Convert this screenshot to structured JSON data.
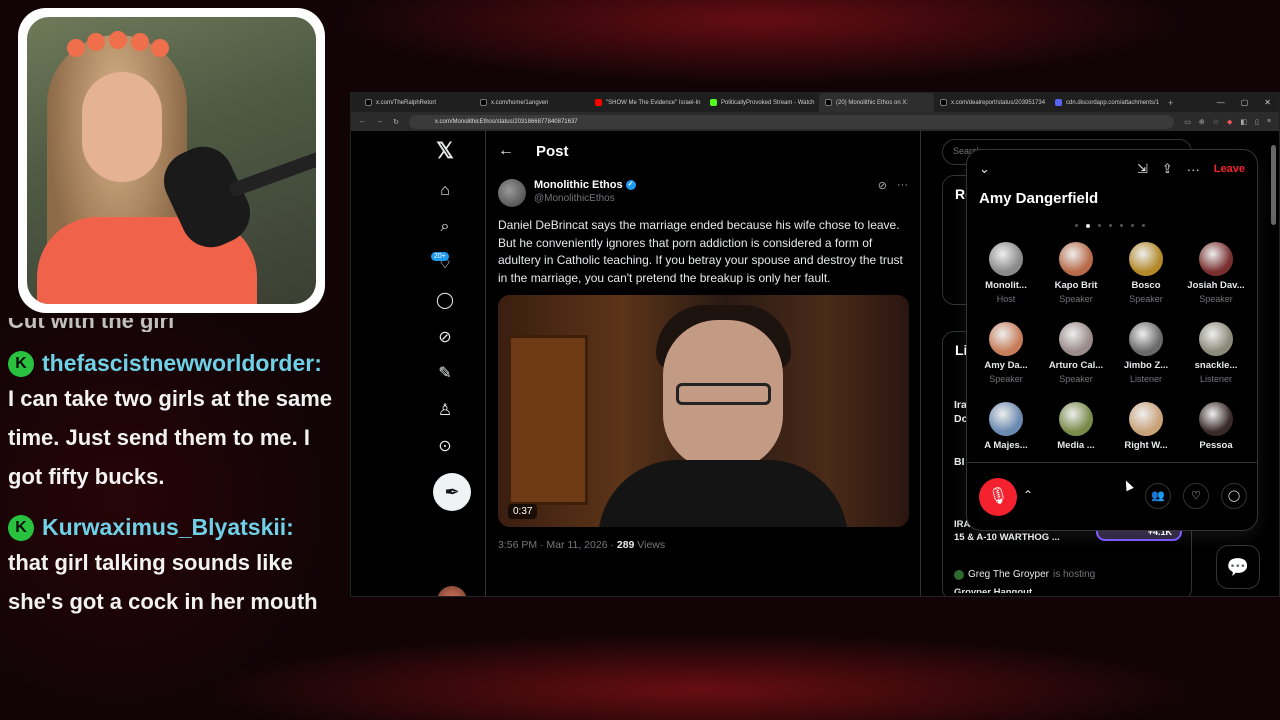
{
  "chat": {
    "cut_line": "Cut with the girl",
    "messages": [
      {
        "badge": "K",
        "user": "thefascistnewworldorder:",
        "text": "I can take two girls at the same time. Just send them to me. I got fifty bucks."
      },
      {
        "badge": "K",
        "user": "Kurwaximus_Blyatskii:",
        "text": "that girl talking sounds like she's got a cock in her mouth"
      }
    ]
  },
  "browser": {
    "tabs": [
      {
        "label": "x.com/TheRalphRetort",
        "color": "#000000"
      },
      {
        "label": "x.com/home/1angven",
        "color": "#000000"
      },
      {
        "label": "\"SHOW Me The Evidence\" Israel-In",
        "color": "#ff0000"
      },
      {
        "label": "PoliticallyProvoked Stream - Watch",
        "color": "#53fc18"
      },
      {
        "label": "(20) Monolithic Ethos on X:",
        "color": "#000000",
        "active": true
      },
      {
        "label": "x.com/dealreport/status/203951734",
        "color": "#000000"
      },
      {
        "label": "cdn.discordapp.com/attachments/1",
        "color": "#5865f2"
      }
    ],
    "url": "x.com/MonolithicEthos/status/2031866877840871637"
  },
  "x": {
    "page_title": "Post",
    "notif_badge": "20+",
    "author_name": "Monolithic Ethos",
    "author_handle": "@MonolithicEthos",
    "post_text": "Daniel DeBrincat says the marriage ended because his wife chose to leave. But he conveniently ignores that porn addiction is considered a form of adultery in Catholic teaching. If you betray your spouse and destroy the trust in the marriage, you can't pretend the breakup is only her fault.",
    "video_time": "0:37",
    "meta_time": "3:56 PM · Mar 11, 2026 · ",
    "views_count": "289",
    "views_label": " Views"
  },
  "sidebar_right": {
    "search_placeholder": "Search",
    "section_re": "Re",
    "section_live": "Liv",
    "live_items": [
      "Ira",
      "Do",
      "BI"
    ],
    "war_line1": "IRAN WAR DAY 5GH",
    "war_line2": "15 & A-10 WARTHOG ...",
    "plus_count": "+4.1K",
    "hosting_name": "Greg The Groyper",
    "hosting_text": " is hosting",
    "hosting_sub": "Groyper Hangout"
  },
  "space": {
    "leave": "Leave",
    "title": "Amy Dangerfield",
    "participants": [
      {
        "name": "Monolit...",
        "role": "Host",
        "color": "#8a8a8a"
      },
      {
        "name": "Kapo Brit",
        "role": "Speaker",
        "color": "#b76a4a"
      },
      {
        "name": "Bosco",
        "role": "Speaker",
        "color": "#b38a2a"
      },
      {
        "name": "Josiah Dav...",
        "role": "Speaker",
        "color": "#7a3030"
      },
      {
        "name": "Amy Da...",
        "role": "Speaker",
        "color": "#c77d5a"
      },
      {
        "name": "Arturo Cal...",
        "role": "Speaker",
        "color": "#9a8a8a"
      },
      {
        "name": "Jimbo Z...",
        "role": "Listener",
        "color": "#6a6a6a"
      },
      {
        "name": "snackle...",
        "role": "Listener",
        "color": "#8a8a7a"
      },
      {
        "name": "A Majes...",
        "role": "",
        "color": "#6a8ab0"
      },
      {
        "name": "Media ...",
        "role": "",
        "color": "#7a8a4a"
      },
      {
        "name": "Right W...",
        "role": "",
        "color": "#c9a27a"
      },
      {
        "name": "Pessoa",
        "role": "",
        "color": "#3a2a2a"
      }
    ]
  },
  "icons": [
    "x-logo-icon",
    "home-icon",
    "search-icon",
    "bell-icon",
    "message-icon",
    "grok-icon",
    "lists-icon",
    "profile-icon",
    "more-icon",
    "compose-icon",
    "mic-muted-icon",
    "people-icon",
    "heart-plus-icon",
    "chat-icon"
  ]
}
